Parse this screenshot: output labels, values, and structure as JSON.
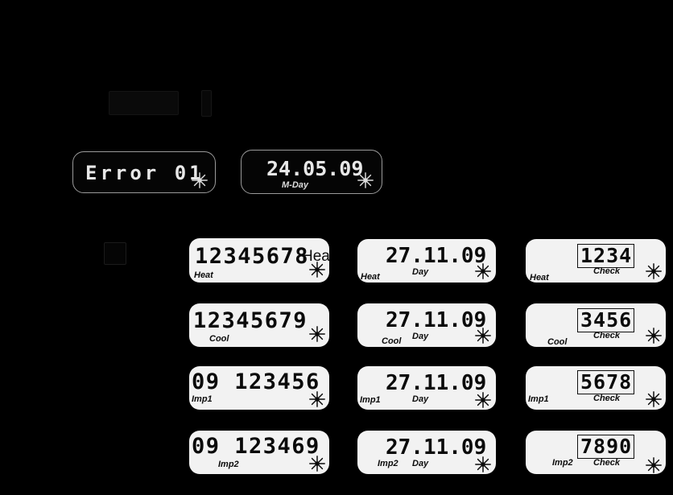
{
  "screen": {
    "background": "#000000",
    "panel_bg": "#f2f2f2",
    "panel_dark_bg": "#050505",
    "digit_color": "#0a0a0a",
    "digit_color_inverted": "#e8e8e8"
  },
  "top_panels": [
    {
      "id": "error-panel",
      "value": "Error 01",
      "sub_label": "",
      "icon": "starburst-icon",
      "style": "dark"
    },
    {
      "id": "mday-panel",
      "value": "24.05.09",
      "sub_label": "M-Day",
      "icon": "starburst-icon",
      "style": "dark"
    }
  ],
  "grid": {
    "columns": [
      "counter",
      "date",
      "check"
    ],
    "rows": [
      {
        "key": "heat",
        "tariff_label": "Heat",
        "counter": {
          "value": "12345678",
          "tag": "Heat",
          "overflow_text": "Heat",
          "icon": "starburst-icon"
        },
        "date": {
          "value": "27.11.09",
          "center_label": "Day",
          "tag": "Heat",
          "icon": "starburst-icon"
        },
        "check": {
          "value": "1234",
          "center_label": "Check",
          "tag": "Heat",
          "icon": "starburst-icon"
        }
      },
      {
        "key": "cool",
        "tariff_label": "Cool",
        "counter": {
          "value": "12345679",
          "tag": "Cool",
          "overflow_text": "",
          "icon": "starburst-icon"
        },
        "date": {
          "value": "27.11.09",
          "center_label": "Day",
          "tag": "Cool",
          "icon": "starburst-icon"
        },
        "check": {
          "value": "3456",
          "center_label": "Check",
          "tag": "Cool",
          "icon": "starburst-icon"
        }
      },
      {
        "key": "imp1",
        "tariff_label": "Imp1",
        "counter": {
          "value": "09 123456",
          "tag": "Imp1",
          "overflow_text": "",
          "icon": "starburst-icon"
        },
        "date": {
          "value": "27.11.09",
          "center_label": "Day",
          "tag": "Imp1",
          "icon": "starburst-icon"
        },
        "check": {
          "value": "5678",
          "center_label": "Check",
          "tag": "Imp1",
          "icon": "starburst-icon"
        }
      },
      {
        "key": "imp2",
        "tariff_label": "Imp2",
        "counter": {
          "value": "09 123469",
          "tag": "Imp2",
          "overflow_text": "",
          "icon": "starburst-icon"
        },
        "date": {
          "value": "27.11.09",
          "center_label": "Day",
          "tag": "Imp2",
          "icon": "starburst-icon"
        },
        "check": {
          "value": "7890",
          "center_label": "Check",
          "tag": "Imp2",
          "icon": "starburst-icon"
        }
      }
    ]
  }
}
